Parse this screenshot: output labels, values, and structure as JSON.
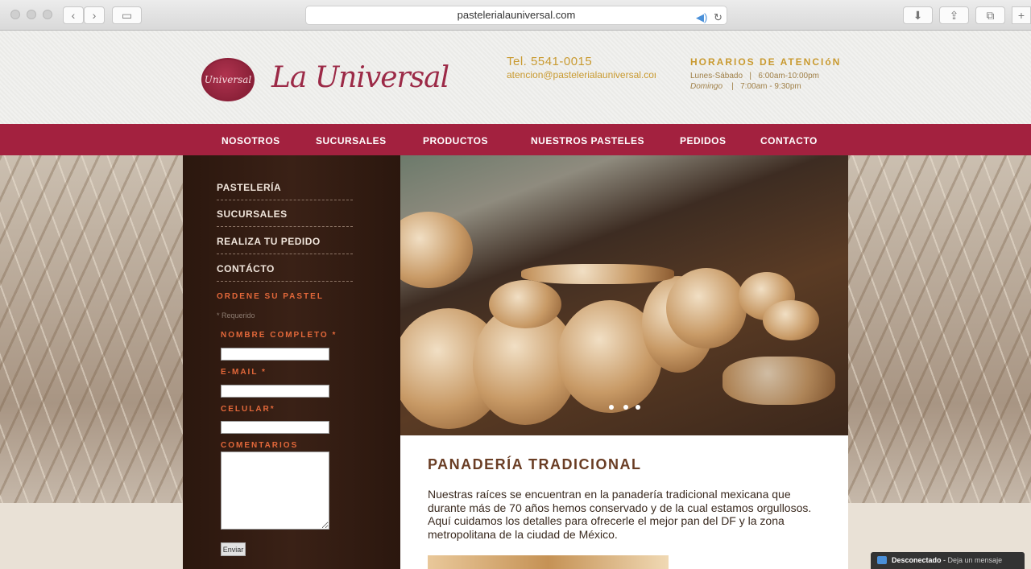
{
  "browser": {
    "url": "pastelerialauniversal.com"
  },
  "header": {
    "seal_text": "Universal",
    "brand": "La Universal",
    "tel": "Tel. 5541-0015",
    "email": "atencion@pastelerialauniversal.com",
    "hours_title": "HORARIOS DE ATENCIóN",
    "hours": [
      {
        "day": "Lunes-Sábado",
        "sep": "|",
        "time": "6:00am-10:00pm"
      },
      {
        "day": "Domingo",
        "sep": "|",
        "time": "7:00am - 9:30pm"
      }
    ]
  },
  "nav": {
    "items": [
      "NOSOTROS",
      "SUCURSALES",
      "PRODUCTOS",
      "NUESTROS PASTELES",
      "PEDIDOS",
      "CONTACTO"
    ]
  },
  "sidebar": {
    "links": [
      "PASTELERÍA",
      "SUCURSALES",
      "REALIZA TU PEDIDO",
      "CONTÁCTO"
    ],
    "order_title": "ORDENE SU PASTEL",
    "required_note": "* Requerido",
    "fields": {
      "name_label": "NOMBRE COMPLETO *",
      "email_label": "E-MAIL *",
      "cell_label": "CELULAR*",
      "comments_label": "COMENTARIOS"
    },
    "submit_label": "Enviar"
  },
  "content": {
    "title": "PANADERÍA TRADICIONAL",
    "body": "Nuestras raíces se encuentran en la panadería tradicional mexicana que durante más de 70 años hemos conservado y de la cual estamos orgullosos. Aquí cuidamos los detalles para ofrecerle el mejor pan del DF y la zona metropolitana de la ciudad de México."
  },
  "chat": {
    "status": "Desconectado",
    "separator": " - ",
    "message": "Deja un mensaje"
  },
  "colors": {
    "brand": "#9c2a47",
    "navbar": "#a3213f",
    "gold": "#c99a30",
    "accent_orange": "#e3683a",
    "sidebar": "#2b170e"
  }
}
